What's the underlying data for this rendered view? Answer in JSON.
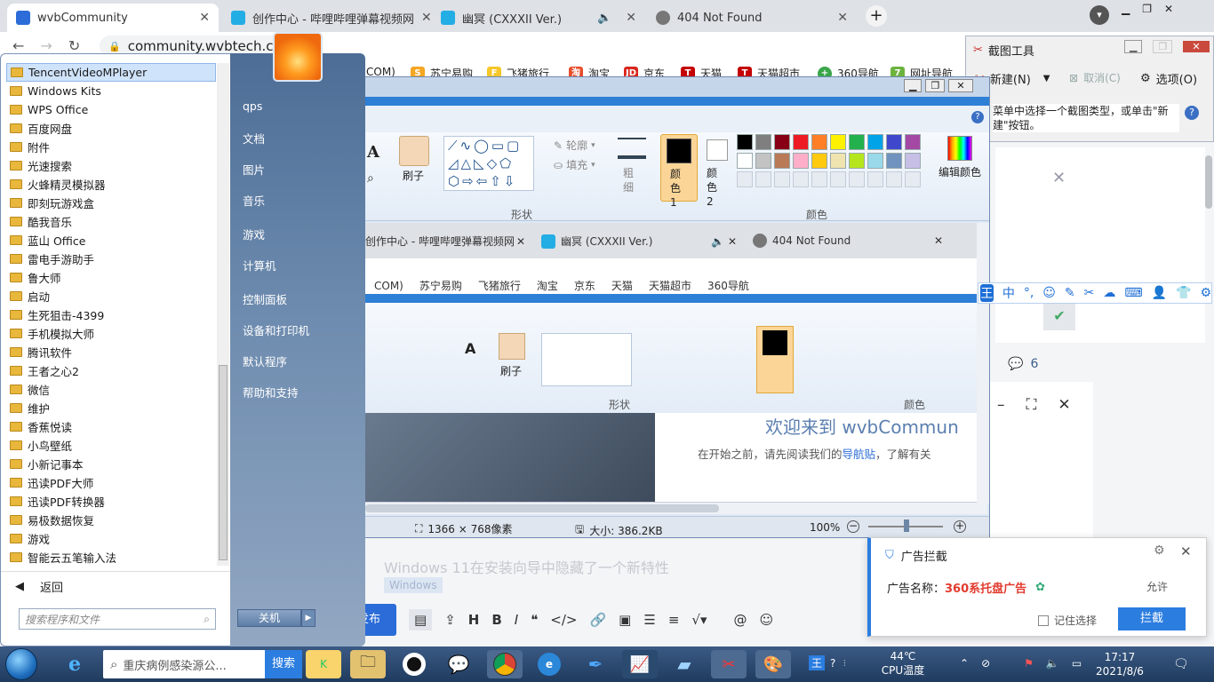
{
  "browser": {
    "tabs": [
      {
        "title": "wvbCommunity",
        "active": true
      },
      {
        "title": "创作中心 - 哔哩哔哩弹幕视频网"
      },
      {
        "title": "幽冥 (CXXXII Ver.)"
      },
      {
        "title": "404 Not Found"
      }
    ],
    "url": "community.wvbtech.com",
    "bookmarks": [
      "COM)",
      "苏宁易购",
      "飞猪旅行",
      "淘宝",
      "京东",
      "天猫",
      "天猫超市",
      "360导航",
      "网址导航"
    ]
  },
  "start_menu": {
    "programs": [
      "TencentVideoMPlayer",
      "Windows Kits",
      "WPS Office",
      "百度网盘",
      "附件",
      "光速搜索",
      "火蜂精灵模拟器",
      "即刻玩游戏盒",
      "酷我音乐",
      "蓝山 Office",
      "雷电手游助手",
      "鲁大师",
      "启动",
      "生死狙击-4399",
      "手机模拟大师",
      "腾讯软件",
      "王者之心2",
      "微信",
      "维护",
      "香蕉悦读",
      "小鸟壁纸",
      "小新记事本",
      "迅读PDF大师",
      "迅读PDF转换器",
      "易极数据恢复",
      "游戏",
      "智能云五笔输入法"
    ],
    "back": "返回",
    "search_placeholder": "搜索程序和文件",
    "right_items": [
      "qps",
      "文档",
      "图片",
      "音乐",
      "游戏",
      "计算机",
      "控制面板",
      "设备和打印机",
      "默认程序",
      "帮助和支持"
    ],
    "shutdown": "关机"
  },
  "paint": {
    "brush": "刷子",
    "outline": "轮廓",
    "fill": "填充",
    "shapes": "形状",
    "size": "粗细",
    "color1": "颜色 1",
    "color2": "颜色 2",
    "colors": "颜色",
    "edit_colors": "编辑颜色",
    "dimensions": "1366 × 768像素",
    "filesize": "大小: 386.2KB",
    "zoom": "100%",
    "palette": [
      "#000000",
      "#7f7f7f",
      "#880015",
      "#ed1c24",
      "#ff7f27",
      "#fff200",
      "#22b14c",
      "#00a2e8",
      "#3f48cc",
      "#a349a4",
      "#ffffff",
      "#c3c3c3",
      "#b97a57",
      "#ffaec9",
      "#ffc90e",
      "#efe4b0",
      "#b5e61d",
      "#99d9ea",
      "#7092be",
      "#c8bfe7"
    ]
  },
  "inner": {
    "welcome": "欢迎来到 wvbCommun",
    "hint_pre": "在开始之前，请先阅读我们的",
    "hint_link": "导航贴",
    "hint_post": "，了解有关",
    "machine": "机"
  },
  "snip": {
    "title": "截图工具",
    "new": "新建(N)",
    "cancel": "取消(C)",
    "options": "选项(O)",
    "hint": "菜单中选择一个截图类型，或单击\"新建\"按钮。"
  },
  "page": {
    "comments": "6",
    "post_title": "Windows 11在安装向导中隐藏了一个新特性",
    "tag": "Windows",
    "publish": "发布"
  },
  "ad": {
    "title": "广告拦截",
    "label": "广告名称：",
    "name": "360系托盘广告",
    "allow": "允许",
    "remember": "记住选择",
    "block": "拦截"
  },
  "taskbar": {
    "search_text": "重庆病例感染源公...",
    "search_btn": "搜索",
    "temp": "44℃",
    "temp_label": "CPU温度",
    "time": "17:17",
    "date": "2021/8/6"
  },
  "colors": {
    "accent": "#2b7de0",
    "ad_red": "#e23b2e",
    "taskbar": "#1f3b5f"
  }
}
